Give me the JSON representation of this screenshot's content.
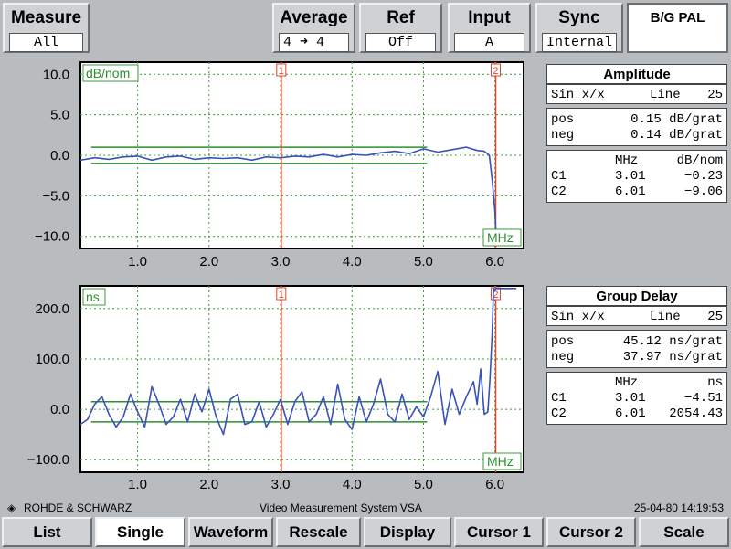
{
  "top_menu": {
    "measure": {
      "label": "Measure",
      "value": "All"
    },
    "average": {
      "label": "Average",
      "value": "4  ➜ 4"
    },
    "ref": {
      "label": "Ref",
      "value": "Off"
    },
    "input": {
      "label": "Input",
      "value": "A"
    },
    "sync": {
      "label": "Sync",
      "value": "Internal"
    },
    "standard": "B/G PAL"
  },
  "amplitude_panel": {
    "title": "Amplitude",
    "signal": "Sin x/x",
    "line_label": "Line",
    "line_value": "25",
    "pos_label": "pos",
    "pos_value": "0.15 dB/grat",
    "neg_label": "neg",
    "neg_value": "0.14 dB/grat",
    "head_freq": "MHz",
    "head_val": "dB/nom",
    "c1_label": "C1",
    "c1_freq": "3.01",
    "c1_val": "−0.23",
    "c2_label": "C2",
    "c2_freq": "6.01",
    "c2_val": "−9.06"
  },
  "delay_panel": {
    "title": "Group Delay",
    "signal": "Sin x/x",
    "line_label": "Line",
    "line_value": "25",
    "pos_label": "pos",
    "pos_value": "45.12 ns/grat",
    "neg_label": "neg",
    "neg_value": "37.97 ns/grat",
    "head_freq": "MHz",
    "head_val": "ns",
    "c1_label": "C1",
    "c1_freq": "3.01",
    "c1_val": "−4.51",
    "c2_label": "C2",
    "c2_freq": "6.01",
    "c2_val": "2054.43"
  },
  "footer": {
    "brand": "ROHDE & SCHWARZ",
    "system": "Video Measurement System VSA",
    "datetime": "25-04-80  14:19:53"
  },
  "softkeys": [
    "List",
    "Single",
    "Waveform",
    "Rescale",
    "Display",
    "Cursor 1",
    "Cursor 2",
    "Scale"
  ],
  "active_softkey": 1,
  "chart_data": [
    {
      "type": "line",
      "unit_label": "dB/nom",
      "x_unit_label": "MHz",
      "xlim": [
        0.2,
        6.4
      ],
      "ylim": [
        -11.5,
        11.5
      ],
      "xticks": [
        "1.0",
        "2.0",
        "3.0",
        "4.0",
        "5.0",
        "6.0"
      ],
      "yticks": [
        "10.0",
        "5.0",
        "0.0",
        "−5.0",
        "−10.0"
      ],
      "ytick_values": [
        10,
        5,
        0,
        -5,
        -10
      ],
      "tolerance_upper": {
        "x": [
          0.35,
          5.05
        ],
        "y": 1.0
      },
      "tolerance_lower": {
        "x": [
          0.35,
          5.05
        ],
        "y": -1.0
      },
      "cursors": [
        {
          "label": "1",
          "x": 3.01
        },
        {
          "label": "2",
          "x": 6.01
        }
      ],
      "grid": true,
      "trace_color": "#3a52b8",
      "cursor_color": "#e0462c",
      "grid_color": "#3b9a3b",
      "series": [
        {
          "x": [
            0.2,
            0.4,
            0.6,
            0.8,
            1.0,
            1.2,
            1.4,
            1.6,
            1.8,
            2.0,
            2.2,
            2.4,
            2.6,
            2.8,
            3.0,
            3.2,
            3.4,
            3.6,
            3.8,
            4.0,
            4.2,
            4.4,
            4.6,
            4.8,
            5.0,
            5.2,
            5.4,
            5.6,
            5.75,
            5.85,
            5.92,
            5.96,
            6.0,
            6.01
          ],
          "y": [
            -0.6,
            -0.3,
            -0.5,
            -0.2,
            -0.1,
            -0.6,
            -0.2,
            -0.1,
            -0.5,
            -0.3,
            -0.4,
            -0.3,
            -0.6,
            -0.2,
            -0.3,
            -0.1,
            -0.2,
            0.1,
            -0.2,
            0.1,
            0.0,
            0.3,
            0.5,
            0.2,
            0.8,
            0.4,
            0.7,
            1.0,
            0.6,
            0.5,
            0.0,
            -3.0,
            -7.0,
            -9.06
          ]
        }
      ]
    },
    {
      "type": "line",
      "unit_label": "ns",
      "x_unit_label": "MHz",
      "xlim": [
        0.2,
        6.4
      ],
      "ylim": [
        -125,
        245
      ],
      "xticks": [
        "1.0",
        "2.0",
        "3.0",
        "4.0",
        "5.0",
        "6.0"
      ],
      "yticks": [
        "200.0",
        "100.0",
        "0.0",
        "−100.0"
      ],
      "ytick_values": [
        200,
        100,
        0,
        -100
      ],
      "tolerance_upper": {
        "x": [
          0.35,
          5.05
        ],
        "y": 15
      },
      "tolerance_lower": {
        "x": [
          0.35,
          5.05
        ],
        "y": -25
      },
      "cursors": [
        {
          "label": "1",
          "x": 3.01
        },
        {
          "label": "2",
          "x": 6.01
        }
      ],
      "grid": true,
      "trace_color": "#3a52b8",
      "cursor_color": "#e0462c",
      "grid_color": "#3b9a3b",
      "series": [
        {
          "x": [
            0.2,
            0.3,
            0.4,
            0.5,
            0.6,
            0.7,
            0.8,
            0.9,
            1.0,
            1.1,
            1.2,
            1.3,
            1.4,
            1.5,
            1.6,
            1.7,
            1.8,
            1.9,
            2.0,
            2.1,
            2.2,
            2.3,
            2.4,
            2.5,
            2.6,
            2.7,
            2.8,
            2.9,
            3.0,
            3.1,
            3.2,
            3.3,
            3.4,
            3.5,
            3.6,
            3.7,
            3.8,
            3.9,
            4.0,
            4.1,
            4.2,
            4.3,
            4.4,
            4.5,
            4.6,
            4.7,
            4.8,
            4.9,
            5.0,
            5.1,
            5.2,
            5.3,
            5.4,
            5.5,
            5.6,
            5.7,
            5.75,
            5.8,
            5.85,
            5.9,
            5.93,
            5.96,
            5.98,
            6.0,
            6.01,
            6.3
          ],
          "y": [
            -30,
            -20,
            10,
            25,
            -10,
            -35,
            -15,
            30,
            -5,
            -35,
            45,
            10,
            -30,
            -15,
            20,
            -25,
            30,
            -5,
            40,
            -15,
            -50,
            20,
            30,
            -30,
            -25,
            15,
            -35,
            -10,
            20,
            -30,
            15,
            35,
            -25,
            -10,
            25,
            -30,
            50,
            -20,
            -40,
            25,
            -25,
            10,
            60,
            -10,
            -25,
            30,
            -20,
            5,
            -15,
            25,
            75,
            -30,
            40,
            -10,
            25,
            55,
            10,
            80,
            -10,
            -5,
            60,
            150,
            240,
            235,
            240,
            240
          ]
        }
      ]
    }
  ]
}
